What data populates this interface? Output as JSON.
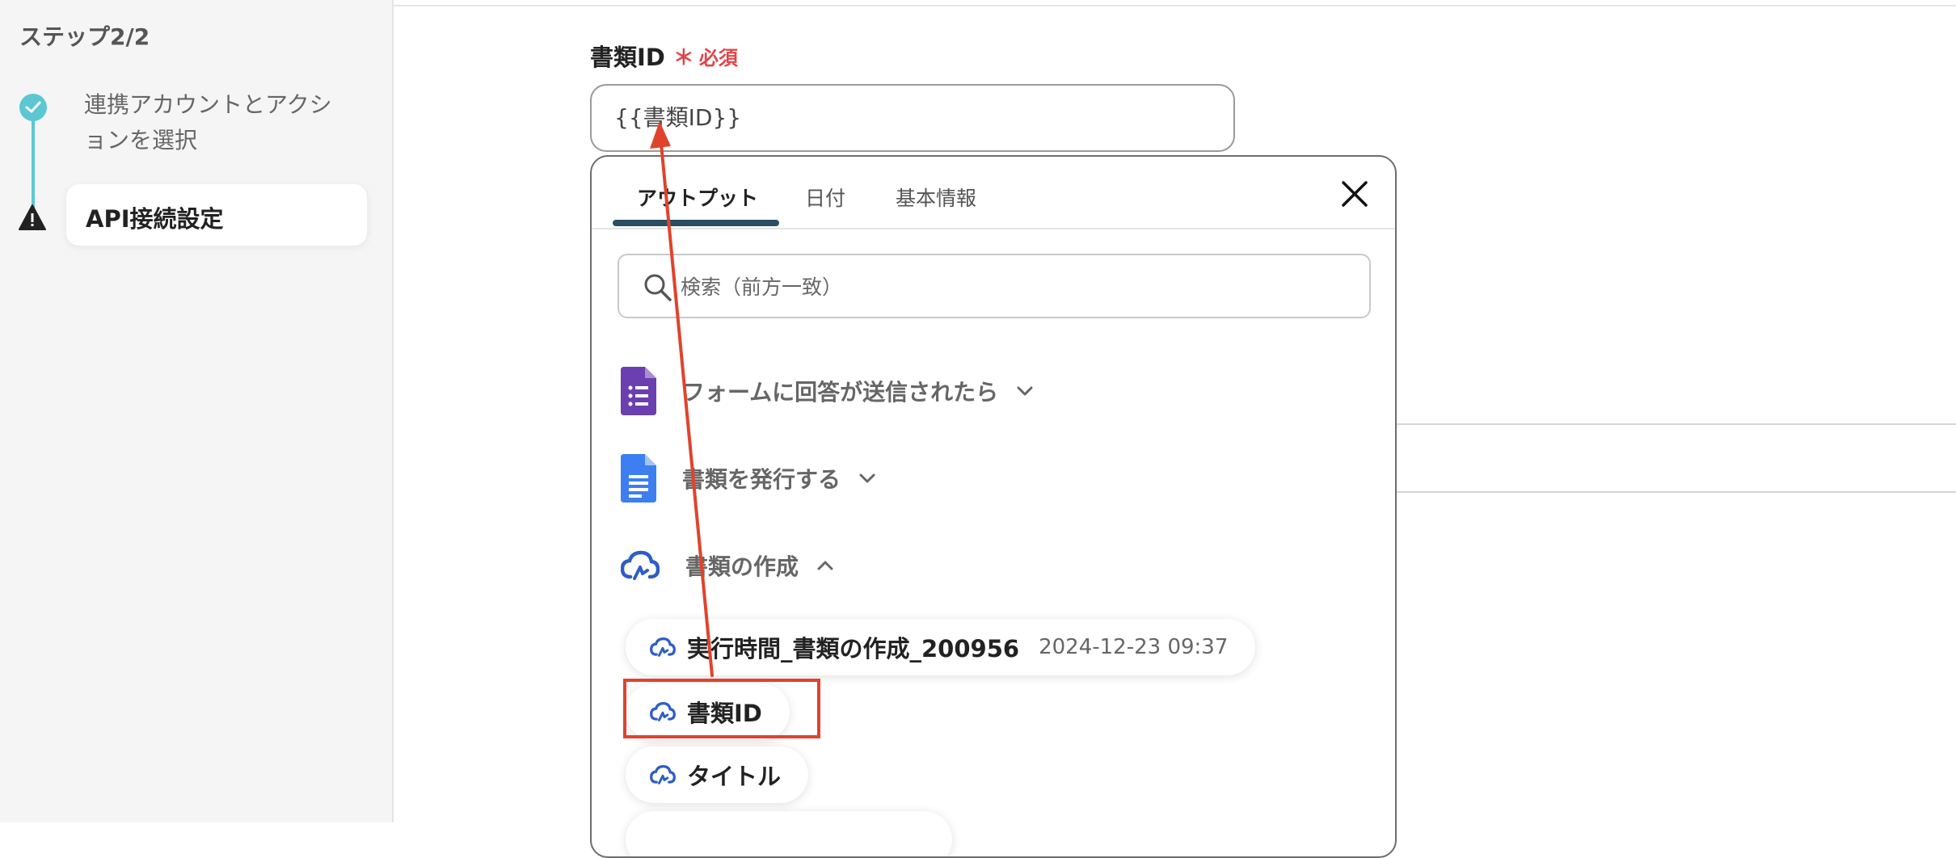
{
  "sidebar": {
    "step_header": "ステップ2/2",
    "steps": [
      {
        "label": "連携アカウントとアクションを選択",
        "status": "done"
      },
      {
        "label": "API接続設定",
        "status": "warning"
      }
    ]
  },
  "field": {
    "label": "書類ID",
    "required_mark": "＊",
    "required_text": "必須",
    "value": "{{書類ID}}"
  },
  "dropdown": {
    "tabs": [
      {
        "label": "アウトプット",
        "active": true
      },
      {
        "label": "日付",
        "active": false
      },
      {
        "label": "基本情報",
        "active": false
      }
    ],
    "search_placeholder": "検索（前方一致）",
    "groups": [
      {
        "label": "フォームに回答が送信されたら",
        "icon": "google-forms-icon",
        "expanded": false
      },
      {
        "label": "書類を発行する",
        "icon": "google-docs-icon",
        "expanded": false
      },
      {
        "label": "書類の作成",
        "icon": "cloud-sign-icon",
        "expanded": true
      }
    ],
    "items": [
      {
        "label": "実行時間_書類の作成_200956",
        "date": "2024-12-23 09:37"
      },
      {
        "label": "書類ID",
        "highlighted": true
      },
      {
        "label": "タイトル"
      }
    ]
  },
  "colors": {
    "accent_teal": "#5cc7d3",
    "tab_underline": "#2a4f63",
    "required_red": "#e0454b",
    "annotation_red": "#e0432c",
    "cloud_icon_blue": "#2e5ec4"
  }
}
